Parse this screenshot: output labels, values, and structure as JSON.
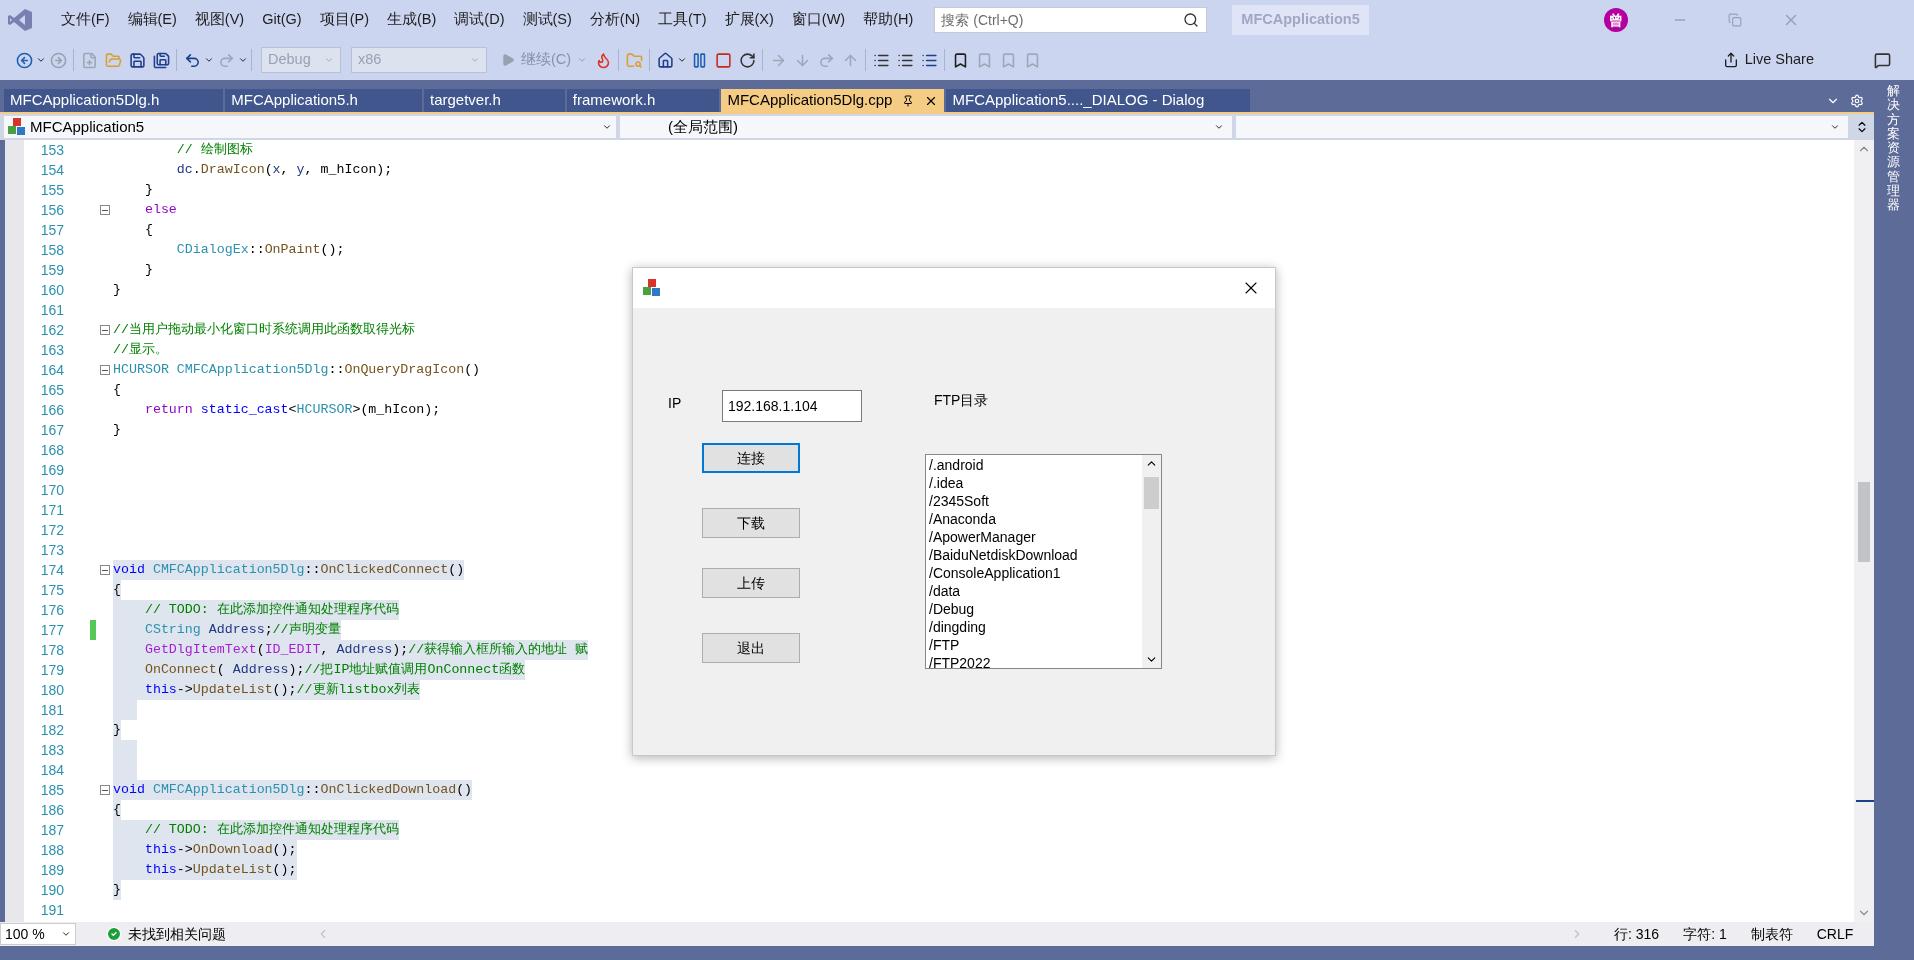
{
  "menu": [
    "文件(F)",
    "编辑(E)",
    "视图(V)",
    "Git(G)",
    "项目(P)",
    "生成(B)",
    "调试(D)",
    "测试(S)",
    "分析(N)",
    "工具(T)",
    "扩展(X)",
    "窗口(W)",
    "帮助(H)"
  ],
  "search": {
    "placeholder": "搜索 (Ctrl+Q)"
  },
  "solution_name": "MFCApplication5",
  "account": {
    "initial": "曾"
  },
  "toolbar": {
    "configuration": "Debug",
    "platform": "x86",
    "continue_label": "继续(C)",
    "live_share": "Live Share"
  },
  "tabs": [
    {
      "label": "MFCApplication5Dlg.h",
      "selected": false
    },
    {
      "label": "MFCApplication5.h",
      "selected": false
    },
    {
      "label": "targetver.h",
      "selected": false
    },
    {
      "label": "framework.h",
      "selected": false
    },
    {
      "label": "MFCApplication5Dlg.cpp",
      "selected": true
    },
    {
      "label": "MFCApplication5...._DIALOG - Dialog",
      "selected": false
    }
  ],
  "nav": {
    "project": "MFCApplication5",
    "scope": "(全局范围)"
  },
  "side_tab": "解决方案资源管理器",
  "editor": {
    "lines": [
      {
        "number": "153",
        "fold": false,
        "changed": false,
        "highlighted": false,
        "tokens": [
          {
            "kind": "comment",
            "text": "        // 绘制图标"
          }
        ]
      },
      {
        "number": "154",
        "fold": false,
        "changed": false,
        "highlighted": false,
        "tokens": [
          {
            "kind": "variable",
            "text": "        dc"
          },
          {
            "kind": "plain",
            "text": "."
          },
          {
            "kind": "function",
            "text": "DrawIcon"
          },
          {
            "kind": "plain",
            "text": "("
          },
          {
            "kind": "variable",
            "text": "x"
          },
          {
            "kind": "plain",
            "text": ", "
          },
          {
            "kind": "variable",
            "text": "y"
          },
          {
            "kind": "plain",
            "text": ", m_hIcon);"
          }
        ]
      },
      {
        "number": "155",
        "fold": false,
        "changed": false,
        "highlighted": false,
        "tokens": [
          {
            "kind": "plain",
            "text": "    }"
          }
        ]
      },
      {
        "number": "156",
        "fold": true,
        "changed": false,
        "highlighted": false,
        "tokens": [
          {
            "kind": "control",
            "text": "    else"
          }
        ]
      },
      {
        "number": "157",
        "fold": false,
        "changed": false,
        "highlighted": false,
        "tokens": [
          {
            "kind": "plain",
            "text": "    {"
          }
        ]
      },
      {
        "number": "158",
        "fold": false,
        "changed": false,
        "highlighted": false,
        "tokens": [
          {
            "kind": "type",
            "text": "        CDialogEx"
          },
          {
            "kind": "plain",
            "text": "::"
          },
          {
            "kind": "function",
            "text": "OnPaint"
          },
          {
            "kind": "plain",
            "text": "();"
          }
        ]
      },
      {
        "number": "159",
        "fold": false,
        "changed": false,
        "highlighted": false,
        "tokens": [
          {
            "kind": "plain",
            "text": "    }"
          }
        ]
      },
      {
        "number": "160",
        "fold": false,
        "changed": false,
        "highlighted": false,
        "tokens": [
          {
            "kind": "plain",
            "text": "}"
          }
        ]
      },
      {
        "number": "161",
        "fold": false,
        "changed": false,
        "highlighted": false
      },
      {
        "number": "162",
        "fold": true,
        "changed": false,
        "highlighted": false,
        "tokens": [
          {
            "kind": "comment",
            "text": "//当用户拖动最小化窗口时系统调用此函数取得光标"
          }
        ]
      },
      {
        "number": "163",
        "fold": false,
        "changed": false,
        "highlighted": false,
        "tokens": [
          {
            "kind": "comment",
            "text": "//显示。"
          }
        ]
      },
      {
        "number": "164",
        "fold": true,
        "changed": false,
        "highlighted": false,
        "tokens": [
          {
            "kind": "type",
            "text": "HCURSOR CMFCApplication5Dlg"
          },
          {
            "kind": "plain",
            "text": "::"
          },
          {
            "kind": "function",
            "text": "OnQueryDragIcon"
          },
          {
            "kind": "plain",
            "text": "()"
          }
        ]
      },
      {
        "number": "165",
        "fold": false,
        "changed": false,
        "highlighted": false,
        "tokens": [
          {
            "kind": "plain",
            "text": "{"
          }
        ]
      },
      {
        "number": "166",
        "fold": false,
        "changed": false,
        "highlighted": false,
        "tokens": [
          {
            "kind": "control",
            "text": "    return "
          },
          {
            "kind": "keyword",
            "text": "static_cast"
          },
          {
            "kind": "plain",
            "text": "<"
          },
          {
            "kind": "type",
            "text": "HCURSOR"
          },
          {
            "kind": "plain",
            "text": ">(m_hIcon);"
          }
        ]
      },
      {
        "number": "167",
        "fold": false,
        "changed": false,
        "highlighted": false,
        "tokens": [
          {
            "kind": "plain",
            "text": "}"
          }
        ]
      },
      {
        "number": "168",
        "fold": false,
        "changed": false,
        "highlighted": false
      },
      {
        "number": "169",
        "fold": false,
        "changed": false,
        "highlighted": false
      },
      {
        "number": "170",
        "fold": false,
        "changed": false,
        "highlighted": false
      },
      {
        "number": "171",
        "fold": false,
        "changed": false,
        "highlighted": false
      },
      {
        "number": "172",
        "fold": false,
        "changed": false,
        "highlighted": false
      },
      {
        "number": "173",
        "fold": false,
        "changed": false,
        "highlighted": false
      },
      {
        "number": "174",
        "fold": true,
        "changed": false,
        "highlighted": true,
        "tokens": [
          {
            "kind": "keyword",
            "text": "void "
          },
          {
            "kind": "type",
            "text": "CMFCApplication5Dlg"
          },
          {
            "kind": "plain",
            "text": "::"
          },
          {
            "kind": "function",
            "text": "OnClickedConnect"
          },
          {
            "kind": "plain",
            "text": "()"
          }
        ]
      },
      {
        "number": "175",
        "fold": false,
        "changed": false,
        "highlighted": true,
        "tokens": [
          {
            "kind": "plain",
            "text": "{"
          }
        ]
      },
      {
        "number": "176",
        "fold": false,
        "changed": false,
        "highlighted": true,
        "tokens": [
          {
            "kind": "comment",
            "text": "    // TODO: 在此添加控件通知处理程序代码"
          }
        ]
      },
      {
        "number": "177",
        "fold": false,
        "changed": true,
        "highlighted": true,
        "tokens": [
          {
            "kind": "type",
            "text": "    CString "
          },
          {
            "kind": "variable",
            "text": "Address"
          },
          {
            "kind": "plain",
            "text": ";"
          },
          {
            "kind": "comment",
            "text": "//声明变量"
          }
        ]
      },
      {
        "number": "178",
        "fold": false,
        "changed": false,
        "highlighted": true,
        "tokens": [
          {
            "kind": "macro",
            "text": "    GetDlgItemText"
          },
          {
            "kind": "plain",
            "text": "("
          },
          {
            "kind": "macro",
            "text": "ID_EDIT"
          },
          {
            "kind": "plain",
            "text": ", "
          },
          {
            "kind": "variable",
            "text": "Address"
          },
          {
            "kind": "plain",
            "text": ");"
          },
          {
            "kind": "comment",
            "text": "//获得输入框所输入的地址 赋"
          }
        ]
      },
      {
        "number": "179",
        "fold": false,
        "changed": false,
        "highlighted": true,
        "tokens": [
          {
            "kind": "function",
            "text": "    OnConnect"
          },
          {
            "kind": "plain",
            "text": "( "
          },
          {
            "kind": "variable",
            "text": "Address"
          },
          {
            "kind": "plain",
            "text": ");"
          },
          {
            "kind": "comment",
            "text": "//把IP地址赋值调用OnConnect函数"
          }
        ]
      },
      {
        "number": "180",
        "fold": false,
        "changed": false,
        "highlighted": true,
        "tokens": [
          {
            "kind": "keyword",
            "text": "    this"
          },
          {
            "kind": "plain",
            "text": "->"
          },
          {
            "kind": "function",
            "text": "UpdateList"
          },
          {
            "kind": "plain",
            "text": "();"
          },
          {
            "kind": "comment",
            "text": "//更新listbox列表"
          }
        ]
      },
      {
        "number": "181",
        "fold": false,
        "changed": false,
        "highlighted": true
      },
      {
        "number": "182",
        "fold": false,
        "changed": false,
        "highlighted": true,
        "tokens": [
          {
            "kind": "plain",
            "text": "}"
          }
        ]
      },
      {
        "number": "183",
        "fold": false,
        "changed": false,
        "highlighted": true
      },
      {
        "number": "184",
        "fold": false,
        "changed": false,
        "highlighted": true
      },
      {
        "number": "185",
        "fold": true,
        "changed": false,
        "highlighted": true,
        "tokens": [
          {
            "kind": "keyword",
            "text": "void "
          },
          {
            "kind": "type",
            "text": "CMFCApplication5Dlg"
          },
          {
            "kind": "plain",
            "text": "::"
          },
          {
            "kind": "function",
            "text": "OnClickedDownload"
          },
          {
            "kind": "plain",
            "text": "()"
          }
        ]
      },
      {
        "number": "186",
        "fold": false,
        "changed": false,
        "highlighted": true,
        "tokens": [
          {
            "kind": "plain",
            "text": "{"
          }
        ]
      },
      {
        "number": "187",
        "fold": false,
        "changed": false,
        "highlighted": true,
        "tokens": [
          {
            "kind": "comment",
            "text": "    // TODO: 在此添加控件通知处理程序代码"
          }
        ]
      },
      {
        "number": "188",
        "fold": false,
        "changed": false,
        "highlighted": true,
        "tokens": [
          {
            "kind": "keyword",
            "text": "    this"
          },
          {
            "kind": "plain",
            "text": "->"
          },
          {
            "kind": "function",
            "text": "OnDownload"
          },
          {
            "kind": "plain",
            "text": "();"
          }
        ]
      },
      {
        "number": "189",
        "fold": false,
        "changed": false,
        "highlighted": true,
        "tokens": [
          {
            "kind": "keyword",
            "text": "    this"
          },
          {
            "kind": "plain",
            "text": "->"
          },
          {
            "kind": "function",
            "text": "UpdateList"
          },
          {
            "kind": "plain",
            "text": "();"
          }
        ]
      },
      {
        "number": "190",
        "fold": false,
        "changed": false,
        "highlighted": true,
        "tokens": [
          {
            "kind": "plain",
            "text": "}"
          }
        ]
      },
      {
        "number": "191",
        "fold": false,
        "changed": false,
        "highlighted": false
      }
    ]
  },
  "dialog": {
    "ip_label": "IP",
    "ip_value": "192.168.1.104",
    "dir_label": "FTP目录",
    "buttons": [
      {
        "label": "连接",
        "focused": true
      },
      {
        "label": "下载",
        "focused": false
      },
      {
        "label": "上传",
        "focused": false
      },
      {
        "label": "退出",
        "focused": false
      }
    ],
    "directory_list": [
      "/.android",
      "/.idea",
      "/2345Soft",
      "/Anaconda",
      "/ApowerManager",
      "/BaiduNetdiskDownload",
      "/ConsoleApplication1",
      "/data",
      "/Debug",
      "/dingding",
      "/FTP",
      "/FTP2022"
    ]
  },
  "status_bar": {
    "zoom": "100 %",
    "issues": "未找到相关问题",
    "line": "行: 316",
    "column": "字符: 1",
    "indentation": "制表符",
    "line_ending": "CRLF"
  }
}
